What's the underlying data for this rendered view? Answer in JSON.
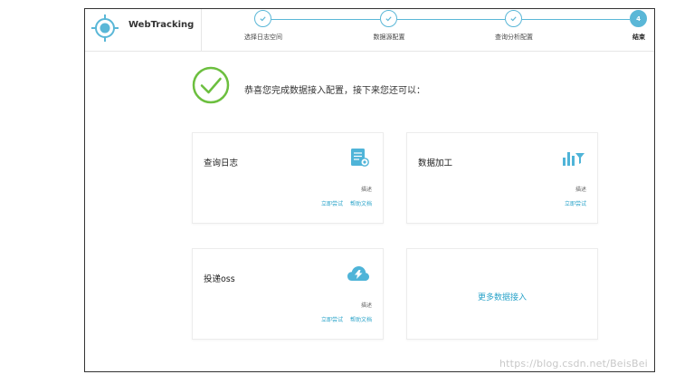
{
  "header": {
    "brand_name": "WebTracking",
    "steps": [
      {
        "number": "",
        "label": "选择日志空间",
        "state": "done"
      },
      {
        "number": "",
        "label": "数据源配置",
        "state": "done"
      },
      {
        "number": "",
        "label": "查询分析配置",
        "state": "done"
      },
      {
        "number": "4",
        "label": "结束",
        "state": "active"
      }
    ]
  },
  "main": {
    "success_message": "恭喜您完成数据接入配置，接下来您还可以：",
    "cards": [
      {
        "title": "查询日志",
        "icon": "log-search-icon",
        "desc": "描述",
        "link_try": "立即尝试",
        "link_help": "帮助文档"
      },
      {
        "title": "数据加工",
        "icon": "bar-chart-filter-icon",
        "desc": "描述",
        "link_try": "立即尝试"
      },
      {
        "title": "投递oss",
        "icon": "cloud-upload-icon",
        "desc": "描述",
        "link_try": "立即尝试",
        "link_help": "帮助文档"
      }
    ],
    "more_label": "更多数据接入"
  },
  "watermark": "https://blog.csdn.net/BeisBei",
  "colors": {
    "accent": "#5ab7d7",
    "link": "#2aa3c9",
    "success": "#6cbf3f"
  }
}
